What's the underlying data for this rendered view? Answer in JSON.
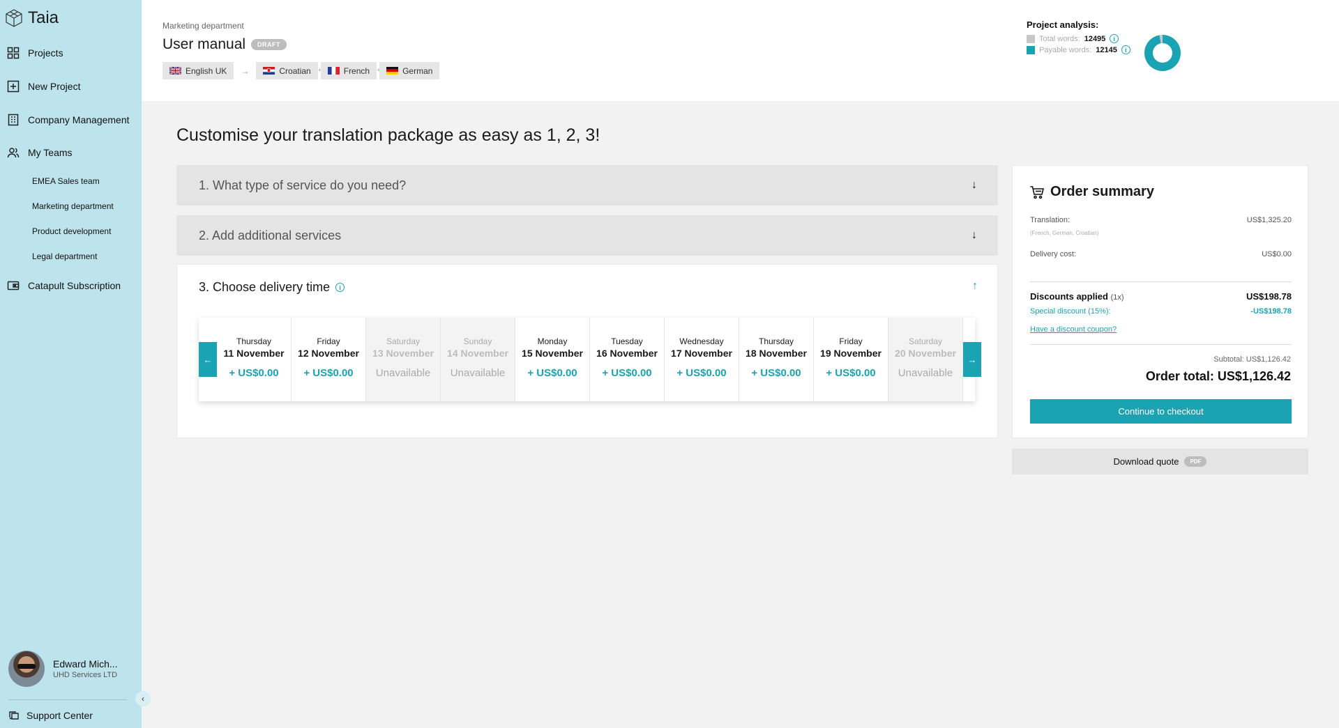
{
  "app": {
    "name": "Taia"
  },
  "sidebar": {
    "items": [
      {
        "label": "Projects",
        "icon": "grid-icon"
      },
      {
        "label": "New Project",
        "icon": "plus-square-icon"
      },
      {
        "label": "Company Management",
        "icon": "building-icon"
      },
      {
        "label": "My Teams",
        "icon": "users-icon"
      },
      {
        "label": "Catapult Subscription",
        "icon": "wallet-icon"
      }
    ],
    "teams": [
      "EMEA Sales team",
      "Marketing department",
      "Product development",
      "Legal department"
    ],
    "user": {
      "name": "Edward Mich...",
      "company": "UHD Services LTD"
    },
    "support_label": "Support Center"
  },
  "header": {
    "breadcrumb": "Marketing department",
    "title": "User manual",
    "badge": "DRAFT",
    "source_language": "English UK",
    "target_languages": [
      "Croatian",
      "French",
      "German"
    ]
  },
  "analysis": {
    "title": "Project analysis:",
    "total_label": "Total words:",
    "total_value": "12495",
    "payable_label": "Payable words:",
    "payable_value": "12145",
    "payable_fraction": 0.972,
    "colors": {
      "total": "#c8c8c8",
      "payable": "#1aa3b3"
    }
  },
  "main": {
    "heading": "Customise your translation package as easy as 1, 2, 3!",
    "step1": "1. What type of service do you need?",
    "step2": "2. Add additional services",
    "step3": "3. Choose delivery time",
    "days": [
      {
        "dow": "Thursday",
        "date": "11 November",
        "price": "+ US$0.00",
        "available": true
      },
      {
        "dow": "Friday",
        "date": "12 November",
        "price": "+ US$0.00",
        "available": true
      },
      {
        "dow": "Saturday",
        "date": "13 November",
        "price": "Unavailable",
        "available": false
      },
      {
        "dow": "Sunday",
        "date": "14 November",
        "price": "Unavailable",
        "available": false
      },
      {
        "dow": "Monday",
        "date": "15 November",
        "price": "+ US$0.00",
        "available": true
      },
      {
        "dow": "Tuesday",
        "date": "16 November",
        "price": "+ US$0.00",
        "available": true
      },
      {
        "dow": "Wednesday",
        "date": "17 November",
        "price": "+ US$0.00",
        "available": true
      },
      {
        "dow": "Thursday",
        "date": "18 November",
        "price": "+ US$0.00",
        "available": true
      },
      {
        "dow": "Friday",
        "date": "19 November",
        "price": "+ US$0.00",
        "available": true
      },
      {
        "dow": "Saturday",
        "date": "20 November",
        "price": "Unavailable",
        "available": false
      }
    ]
  },
  "summary": {
    "title": "Order summary",
    "translation_label": "Translation:",
    "translation_value": "US$1,325.20",
    "translation_note": "(French, German, Croatian)",
    "delivery_label": "Delivery cost:",
    "delivery_value": "US$0.00",
    "discounts_label": "Discounts applied",
    "discounts_count": "(1x)",
    "discounts_value": "US$198.78",
    "special_label": "Special discount (15%):",
    "special_value": "-US$198.78",
    "coupon_link": "Have a discount coupon?",
    "subtotal": "Subtotal: US$1,126.42",
    "total": "Order total: US$1,126.42",
    "checkout_label": "Continue to checkout",
    "download_label": "Download quote",
    "download_badge": "PDF"
  }
}
